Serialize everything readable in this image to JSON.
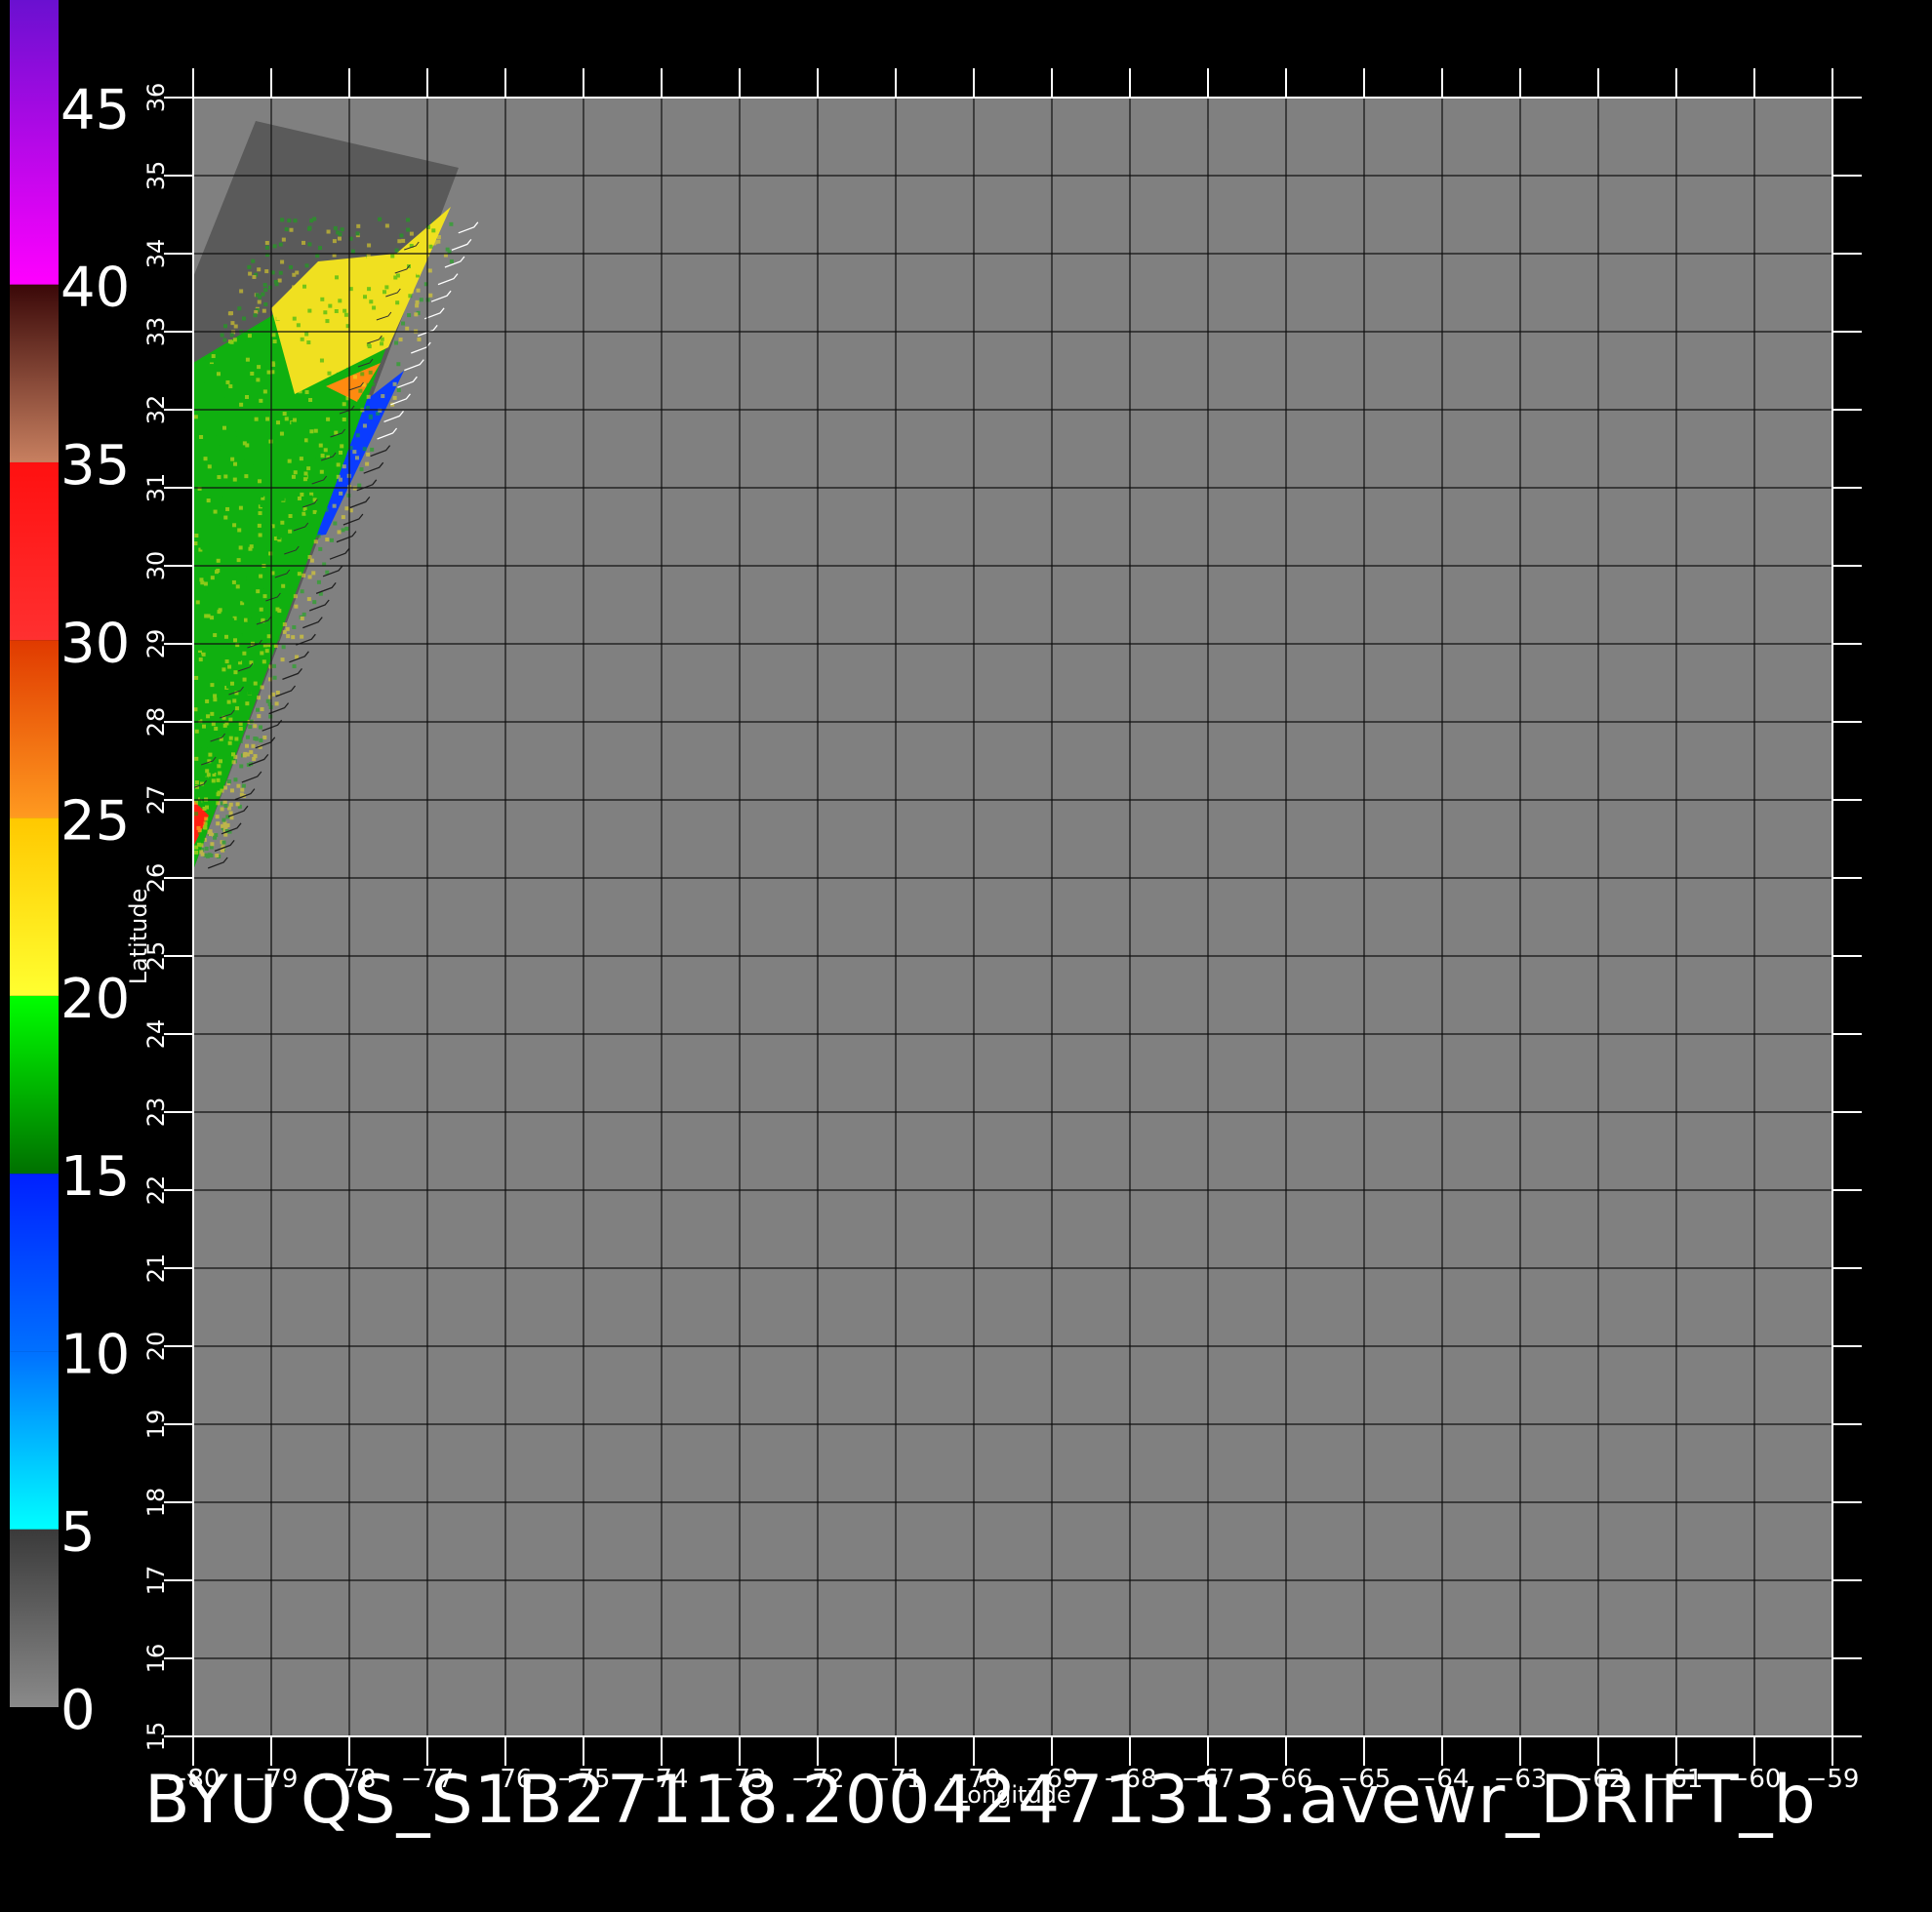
{
  "title": "BYU QS_S1B27118.20042471313.avewr_DRIFT_b",
  "x_axis": {
    "label": "Longitude",
    "ticks": [
      "-80",
      "-79",
      "-78",
      "-77",
      "-76",
      "-75",
      "-74",
      "-73",
      "-72",
      "-71",
      "-70",
      "-69",
      "-68",
      "-67",
      "-66",
      "-65",
      "-64",
      "-63",
      "-62",
      "-61",
      "-60",
      "-59"
    ]
  },
  "y_axis": {
    "label": "Latitude",
    "ticks": [
      "15",
      "16",
      "17",
      "18",
      "19",
      "20",
      "21",
      "22",
      "23",
      "24",
      "25",
      "26",
      "27",
      "28",
      "29",
      "30",
      "31",
      "32",
      "33",
      "34",
      "35",
      "36"
    ]
  },
  "colorbar": {
    "tick_labels": [
      "0",
      "5",
      "10",
      "15",
      "20",
      "25",
      "30",
      "35",
      "40",
      "45"
    ],
    "segments": [
      {
        "from": 0,
        "to": 5,
        "top": "#3a3a3a",
        "bottom": "#8a8a8a"
      },
      {
        "from": 5,
        "to": 10,
        "top": "#0070ff",
        "bottom": "#00ffff"
      },
      {
        "from": 10,
        "to": 15,
        "top": "#0020ff",
        "bottom": "#0070ff"
      },
      {
        "from": 15,
        "to": 20,
        "top": "#00ff00",
        "bottom": "#007000"
      },
      {
        "from": 20,
        "to": 25,
        "top": "#ffc800",
        "bottom": "#ffff30"
      },
      {
        "from": 25,
        "to": 30,
        "top": "#e03a00",
        "bottom": "#ff9a20"
      },
      {
        "from": 30,
        "to": 35,
        "top": "#ff1010",
        "bottom": "#ff3030"
      },
      {
        "from": 35,
        "to": 40,
        "top": "#3a0808",
        "bottom": "#c88060"
      },
      {
        "from": 40,
        "to": 48,
        "top": "#6a10d0",
        "bottom": "#ff00ff"
      }
    ]
  },
  "colors": {
    "background": "#000000",
    "map_fill": "#808080",
    "swath_gray": "#5a5a5a",
    "grid": "#101010",
    "wind_low": "#0a3cff",
    "wind_mid": "#10b010",
    "wind_high": "#f0e020",
    "wind_peak": "#ff2010"
  },
  "chart_data": {
    "type": "heatmap",
    "xlabel": "Longitude",
    "ylabel": "Latitude",
    "xlim": [
      -80,
      -59
    ],
    "ylim": [
      15,
      36
    ],
    "colorbar_range": [
      0,
      48
    ],
    "swath_outline": [
      [
        -79.2,
        35.7
      ],
      [
        -76.6,
        35.1
      ],
      [
        -80,
        26.1
      ],
      [
        -80,
        33.7
      ]
    ],
    "wind_regions": [
      {
        "band": "10-15",
        "polygon": [
          [
            -80,
            32.1
          ],
          [
            -78.2,
            31.8
          ],
          [
            -77.3,
            32.5
          ],
          [
            -78.3,
            30.4
          ],
          [
            -80,
            30.2
          ]
        ]
      },
      {
        "band": "15-20",
        "polygon": [
          [
            -80,
            32.6
          ],
          [
            -79.0,
            33.2
          ],
          [
            -78.4,
            33.8
          ],
          [
            -77.2,
            33.8
          ],
          [
            -76.9,
            34.5
          ],
          [
            -80,
            26.1
          ]
        ]
      },
      {
        "band": "20-25",
        "polygon": [
          [
            -79.0,
            33.3
          ],
          [
            -78.4,
            33.9
          ],
          [
            -77.4,
            34.0
          ],
          [
            -76.7,
            34.6
          ],
          [
            -77.5,
            32.8
          ],
          [
            -78.7,
            32.2
          ]
        ]
      },
      {
        "band": "25-30",
        "polygon": [
          [
            -78.3,
            32.3
          ],
          [
            -77.6,
            32.6
          ],
          [
            -77.9,
            32.1
          ]
        ]
      },
      {
        "band": "30-35",
        "polygon": [
          [
            -80,
            27.0
          ],
          [
            -79.8,
            26.8
          ],
          [
            -80,
            26.4
          ]
        ]
      }
    ]
  }
}
